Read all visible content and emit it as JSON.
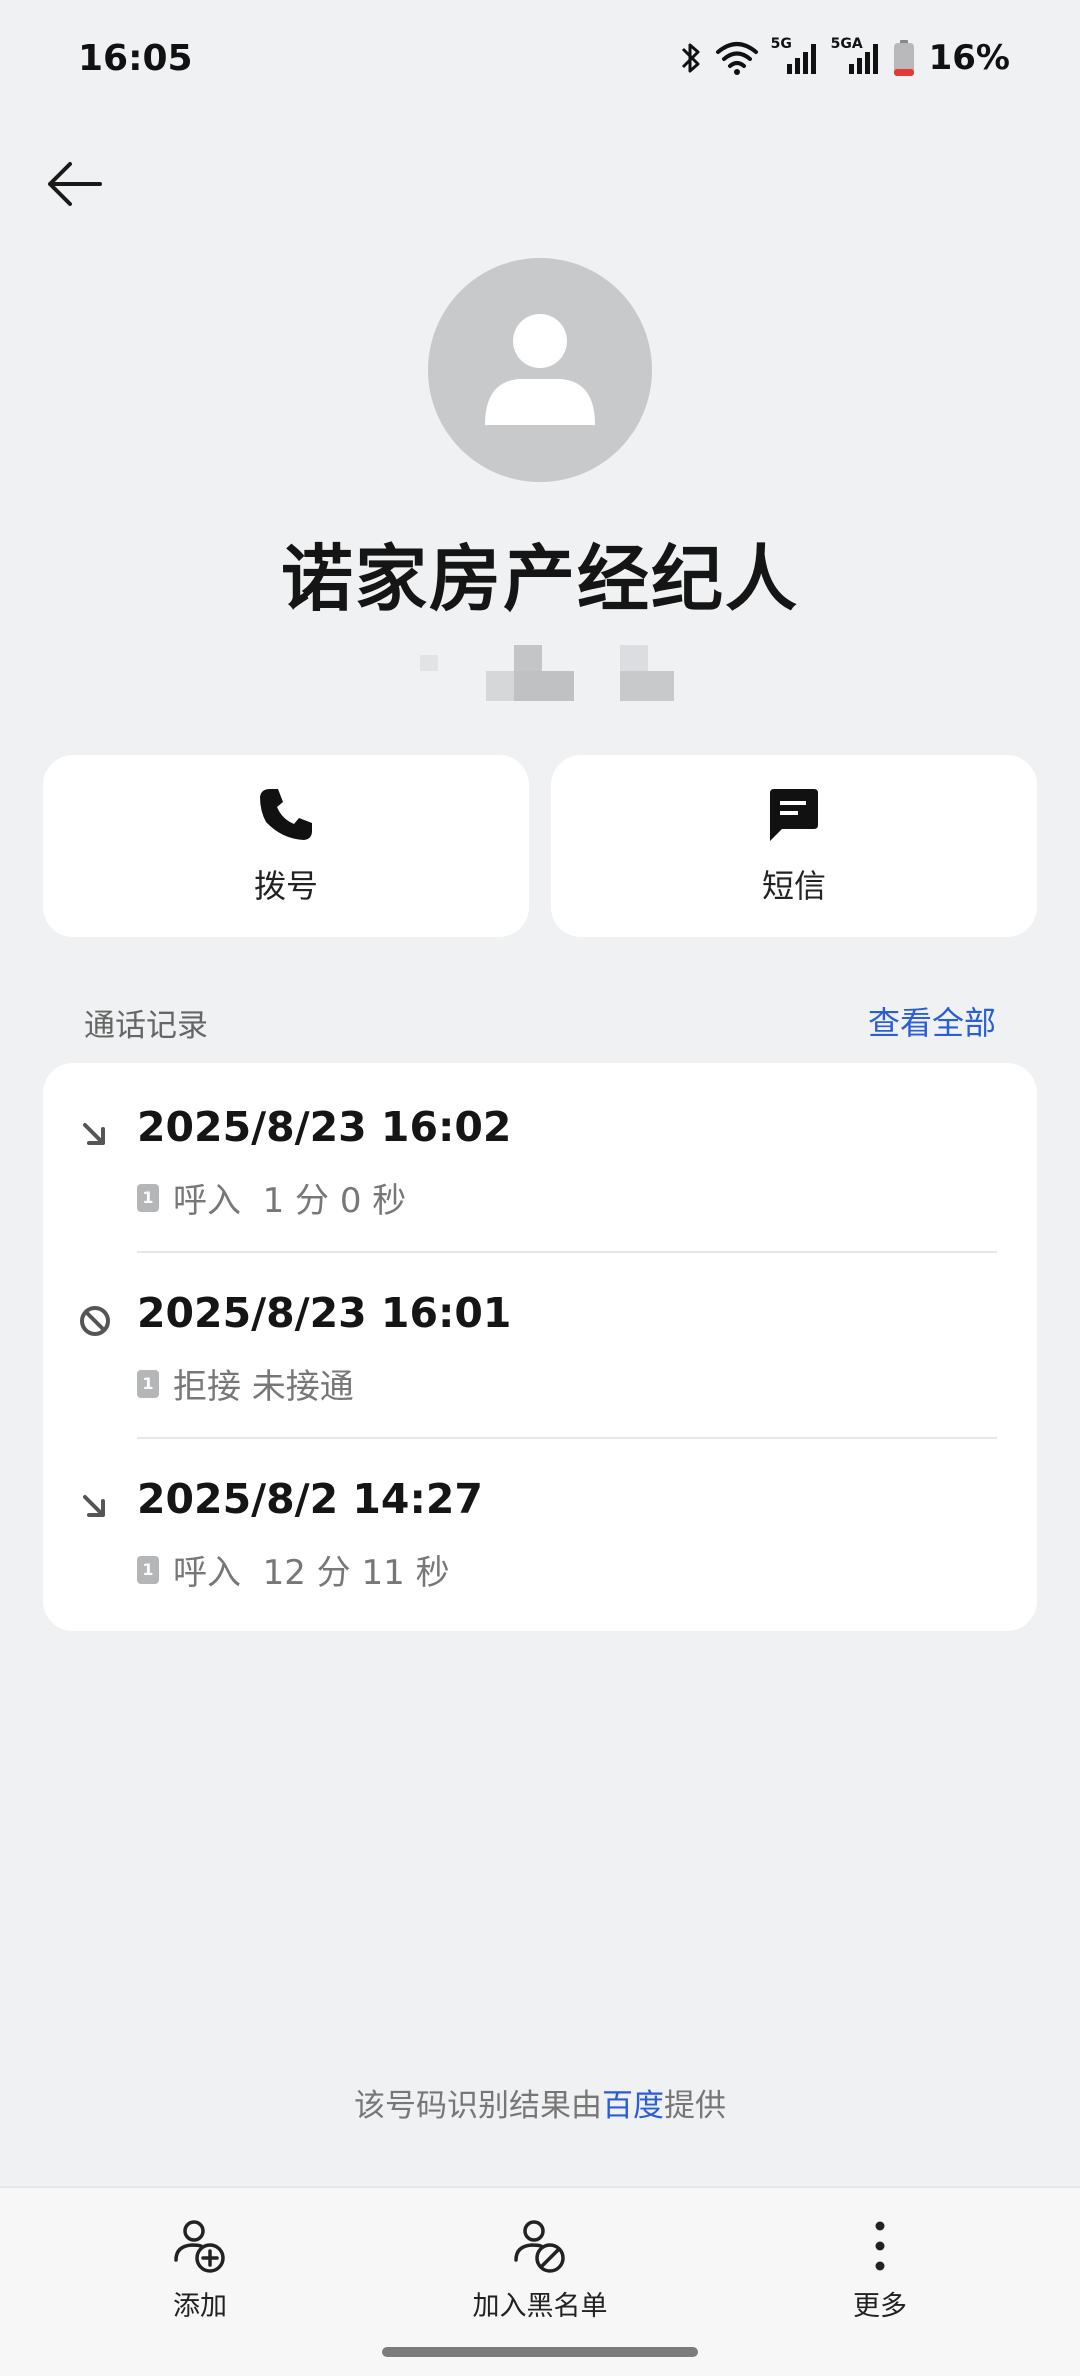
{
  "status_bar": {
    "time": "16:05",
    "battery": "16%",
    "net1": "5G",
    "net2": "5GA",
    "icons": [
      "bluetooth-icon",
      "wifi-icon",
      "signal-icon",
      "battery-icon"
    ]
  },
  "contact": {
    "name": "诺家房产经纪人"
  },
  "actions": {
    "call_label": "拨号",
    "sms_label": "短信"
  },
  "call_log": {
    "title": "通话记录",
    "view_all": "查看全部",
    "sim": "1",
    "entries": [
      {
        "time": "2025/8/23 16:02",
        "detail": "呼入  1 分 0 秒",
        "type": "incoming"
      },
      {
        "time": "2025/8/23 16:01",
        "detail": "拒接 未接通",
        "type": "rejected"
      },
      {
        "time": "2025/8/2 14:27",
        "detail": "呼入  12 分 11 秒",
        "type": "incoming"
      }
    ]
  },
  "provider": {
    "prefix": "该号码识别结果由",
    "link": "百度",
    "suffix": "提供"
  },
  "bottom_bar": {
    "add_label": "添加",
    "block_label": "加入黑名单",
    "more_label": "更多"
  },
  "colors": {
    "background": "#f0f1f3",
    "card": "#ffffff",
    "accent": "#2a5dd6",
    "avatar": "#c8c9cb"
  }
}
